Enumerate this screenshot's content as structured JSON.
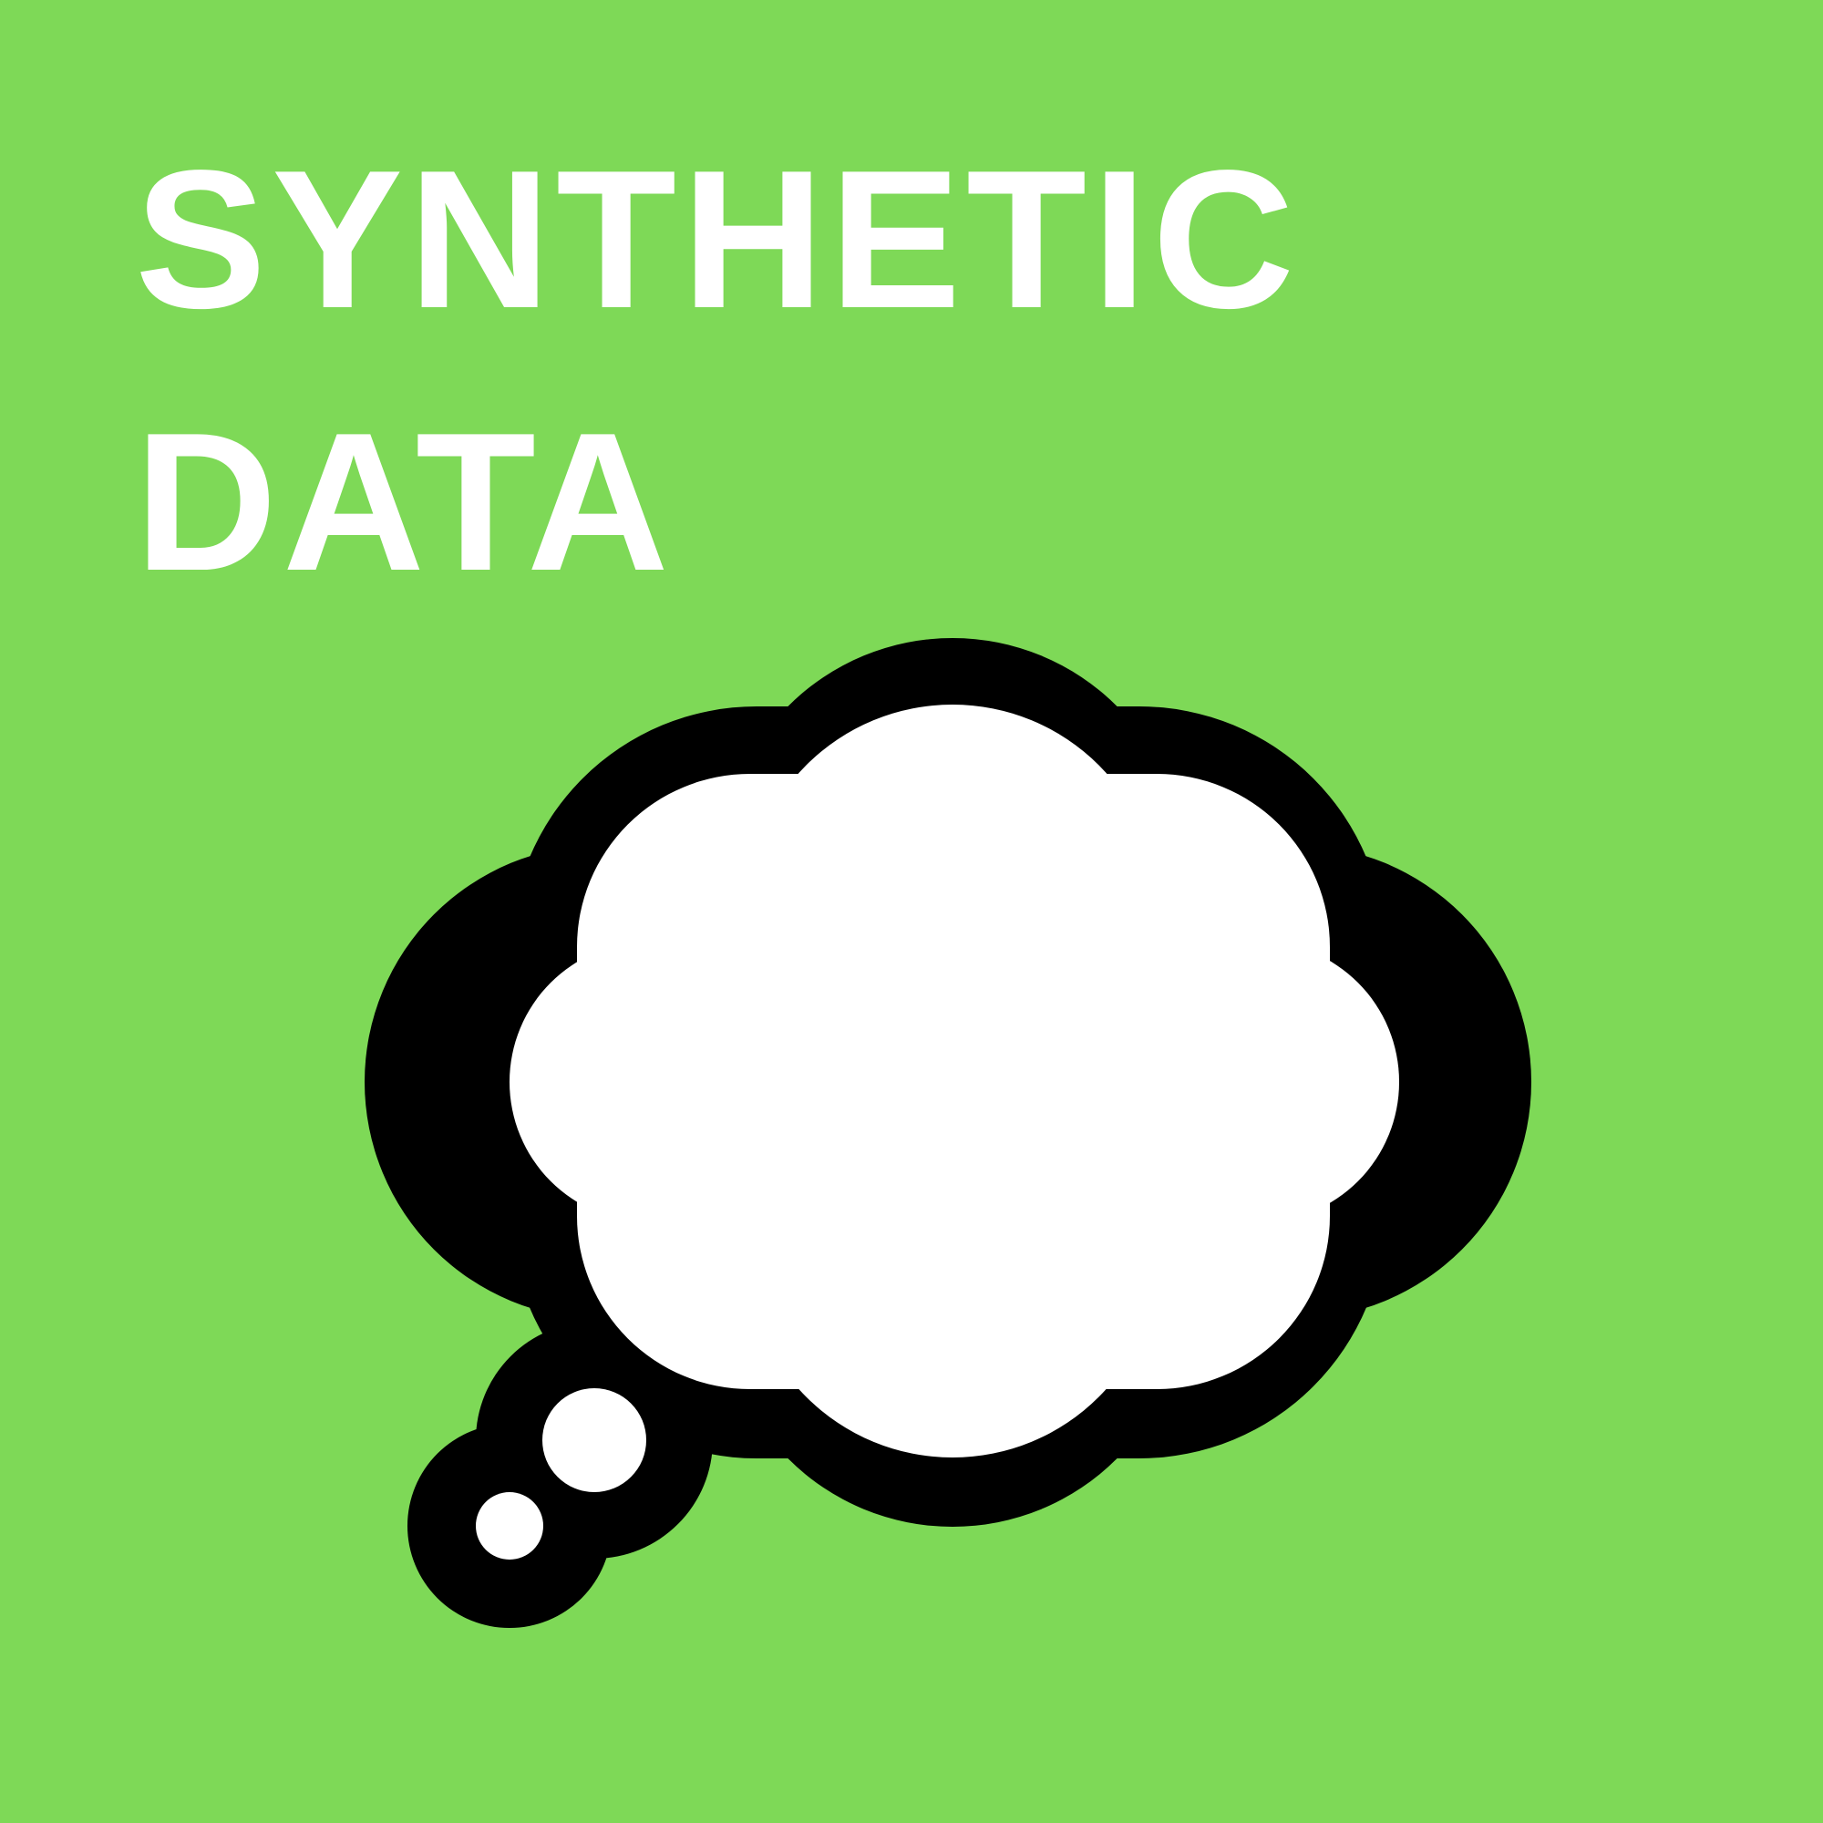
{
  "title": {
    "line1": "SYNTHETIC",
    "line2": "DATA"
  },
  "colors": {
    "background": "#7ed957",
    "text": "#ffffff",
    "bubble_fill": "#ffffff",
    "bubble_outline": "#000000"
  },
  "graphic": {
    "icon": "thought-bubble-icon"
  }
}
